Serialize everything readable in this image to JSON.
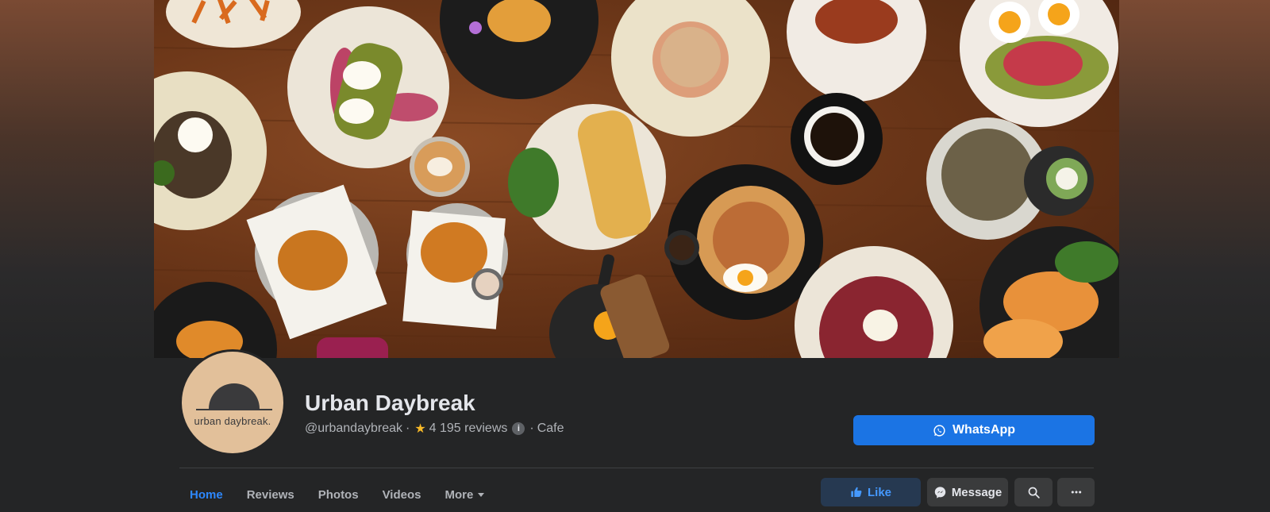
{
  "page": {
    "name": "Urban Daybreak",
    "handle": "@urbandaybreak",
    "rating_separator": "·",
    "reviews_count": "4 195 reviews",
    "category_separator": "·",
    "category": "Cafe",
    "logo_text": "urban daybreak."
  },
  "primary_action": {
    "label": "WhatsApp"
  },
  "tabs": [
    {
      "label": "Home",
      "active": true
    },
    {
      "label": "Reviews"
    },
    {
      "label": "Photos"
    },
    {
      "label": "Videos"
    },
    {
      "label": "More"
    }
  ],
  "actions": {
    "like_label": "Like",
    "message_label": "Message"
  },
  "icons": {
    "star": "star-icon",
    "info": "info-icon",
    "whatsapp": "whatsapp-icon",
    "like": "thumbs-up-icon",
    "message": "messenger-icon",
    "search": "search-icon",
    "more": "more-dots-icon"
  },
  "colors": {
    "accent": "#1b74e4",
    "tab_active": "#2d88ff",
    "like_bg": "#263951",
    "avatar_bg": "#e2c09a",
    "star": "#f7b928"
  }
}
